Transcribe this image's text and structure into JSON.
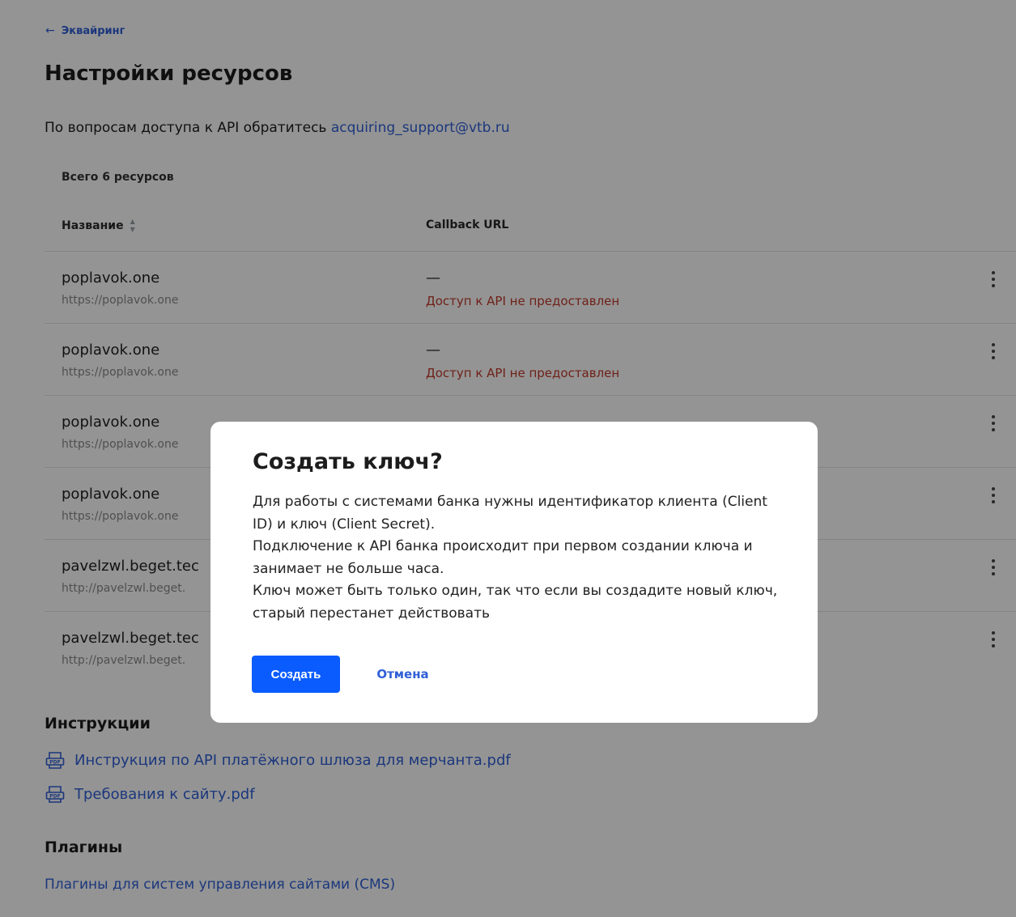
{
  "breadcrumb": {
    "label": "Эквайринг"
  },
  "page": {
    "title": "Настройки ресурсов"
  },
  "support": {
    "text": "По вопросам доступа к API обратитесь",
    "email": "acquiring_support@vtb.ru"
  },
  "resources": {
    "total": "Всего 6 ресурсов",
    "columns": {
      "name": "Название",
      "callback": "Callback URL"
    },
    "rows": [
      {
        "name": "poplavok.one",
        "url": "https://poplavok.one",
        "callback": "—",
        "status": "Доступ к API не предоставлен"
      },
      {
        "name": "poplavok.one",
        "url": "https://poplavok.one",
        "callback": "—",
        "status": "Доступ к API не предоставлен"
      },
      {
        "name": "poplavok.one",
        "url": "https://poplavok.one",
        "callback": "",
        "status": ""
      },
      {
        "name": "poplavok.one",
        "url": "https://poplavok.one",
        "callback": "",
        "status": ""
      },
      {
        "name": "pavelzwl.beget.tec",
        "url": "http://pavelzwl.beget.",
        "callback": "",
        "status": ""
      },
      {
        "name": "pavelzwl.beget.tec",
        "url": "http://pavelzwl.beget.",
        "callback": "",
        "status": ""
      }
    ]
  },
  "instructions": {
    "heading": "Инструкции",
    "docs": [
      {
        "label": "Инструкция по API платёжного шлюза для мерчанта.pdf",
        "icon": "pdf-icon"
      },
      {
        "label": "Требования к сайту.pdf",
        "icon": "pdf-icon"
      }
    ]
  },
  "plugins": {
    "heading": "Плагины",
    "link": "Плагины для систем управления сайтами (CMS)"
  },
  "dialog": {
    "title": "Создать ключ?",
    "body": [
      "Для работы с системами банка нужны идентификатор клиента (Client ID) и ключ (Client Secret).",
      "Подключение к API банка происходит при первом создании ключа и занимает не больше часа.",
      "Ключ может быть только один, так что если вы создадите новый ключ, старый перестанет действовать"
    ],
    "confirm_label": "Создать",
    "cancel_label": "Отмена"
  },
  "colors": {
    "accent": "#0a5cff",
    "link": "#2f5fd6",
    "error": "#c0392b",
    "overlay": "rgba(0,0,0,0.42)"
  }
}
